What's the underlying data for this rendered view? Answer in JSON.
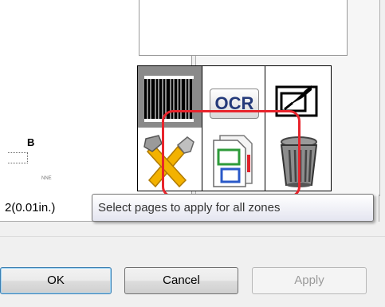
{
  "preview": {
    "letter": "B",
    "tiny_text": "NNE"
  },
  "toolbar": {
    "ocr_label": "OCR",
    "icons": [
      "barcode-icon",
      "ocr-icon",
      "signature-icon",
      "tools-icon",
      "pages-zones-icon",
      "trash-icon"
    ]
  },
  "highlight_color": "#e8242c",
  "tooltip": {
    "text": "Select pages to apply for all zones"
  },
  "field": {
    "resolution_value": "2(0.01in.)"
  },
  "buttons": {
    "ok": "OK",
    "cancel": "Cancel",
    "apply": "Apply"
  }
}
